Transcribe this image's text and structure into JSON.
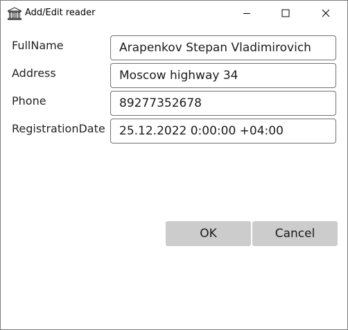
{
  "window": {
    "title": "Add/Edit reader",
    "app_icon": "building-columns-icon",
    "controls": [
      "minimize-icon",
      "maximize-icon",
      "close-icon"
    ]
  },
  "form": {
    "fields": [
      {
        "label": "FullName",
        "value": "Arapenkov Stepan Vladimirovich"
      },
      {
        "label": "Address",
        "value": "Moscow highway 34"
      },
      {
        "label": "Phone",
        "value": "89277352678"
      },
      {
        "label": "RegistrationDate",
        "value": "25.12.2022 0:00:00 +04:00"
      }
    ]
  },
  "buttons": {
    "ok_label": "OK",
    "cancel_label": "Cancel"
  },
  "colors": {
    "button_bg": "#cccccc",
    "field_border": "#707070",
    "window_border": "#7a7a7a"
  }
}
